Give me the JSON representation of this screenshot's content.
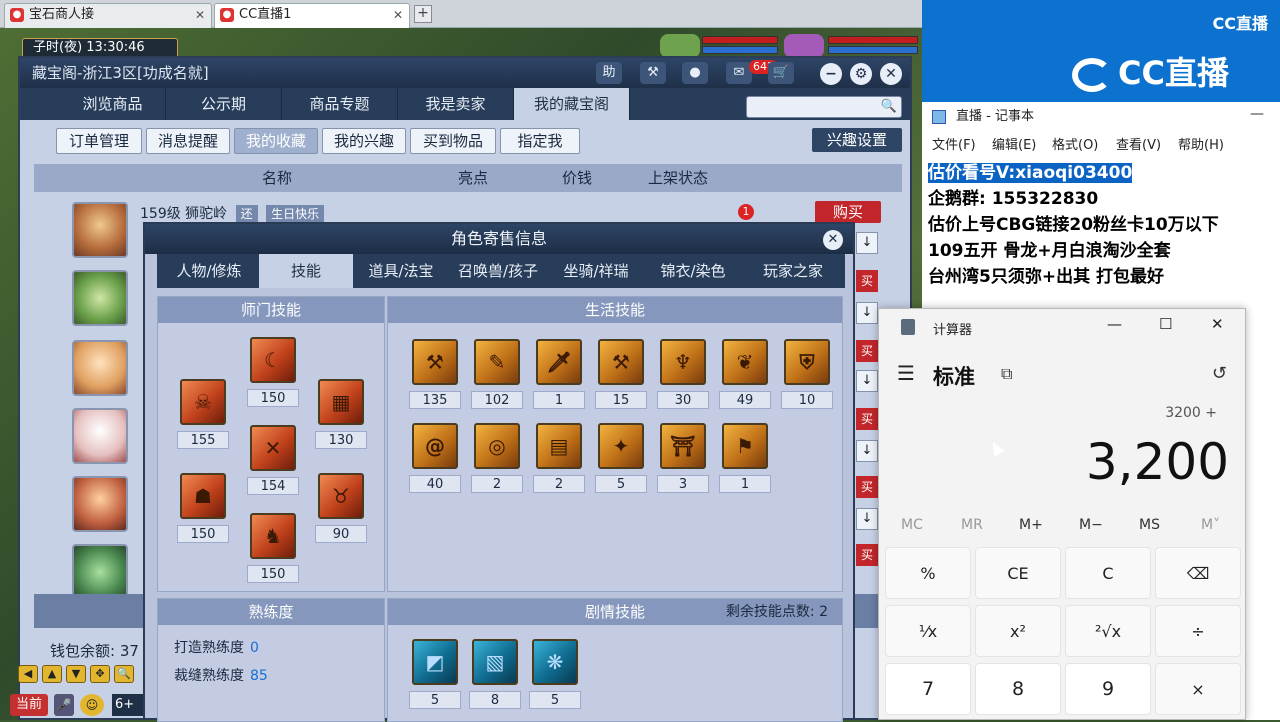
{
  "browser": {
    "tabs": [
      {
        "label": "宝石商人接",
        "active": false
      },
      {
        "label": "CC直播1",
        "active": true
      }
    ]
  },
  "game": {
    "time": "子时(夜)  13:30:46",
    "window_title": "藏宝阁-浙江3区[功成名就]",
    "help_label": "助",
    "message_count": "641",
    "tabs": [
      "浏览商品",
      "公示期",
      "商品专题",
      "我是卖家",
      "我的藏宝阁"
    ],
    "active_tab": 4,
    "subtabs": [
      "订单管理",
      "消息提醒",
      "我的收藏",
      "我的兴趣",
      "买到物品",
      "指定我"
    ],
    "active_subtab": 2,
    "interest_settings": "兴趣设置",
    "columns": [
      "名称",
      "亮点",
      "价钱",
      "上架状态"
    ],
    "row1": {
      "level": "159级 狮驼岭",
      "tag1": "还",
      "tag2": "生日快乐",
      "buy": "购买",
      "notif": "1"
    },
    "side_buttons": [
      "买",
      "买",
      "买",
      "买",
      "买"
    ],
    "wallet": "钱包余额: 37",
    "current_channel": "当前",
    "input_hint": "6+"
  },
  "role_dialog": {
    "title": "角色寄售信息",
    "tabs": [
      "人物/修炼",
      "技能",
      "道具/法宝",
      "召唤兽/孩子",
      "坐骑/祥瑞",
      "锦衣/染色",
      "玩家之家"
    ],
    "active_tab": 1,
    "school_skills_title": "师门技能",
    "life_skills_title": "生活技能",
    "proficiency_title": "熟练度",
    "story_skills_title": "剧情技能",
    "remaining_points_label": "剩余技能点数: 2",
    "school_skills": [
      {
        "icon": "demon-mask-icon",
        "value": "155"
      },
      {
        "icon": "sickle-icon",
        "value": "150"
      },
      {
        "icon": "rune-book-icon",
        "value": "130"
      },
      {
        "icon": "crossed-blades-icon",
        "value": "154"
      },
      {
        "icon": "skull-icon",
        "value": "150"
      },
      {
        "icon": "horns-icon",
        "value": "90"
      },
      {
        "icon": "beast-head-icon",
        "value": "150"
      }
    ],
    "life_skills": [
      {
        "icon": "forge-icon",
        "value": "135"
      },
      {
        "icon": "scroll-icon",
        "value": "102"
      },
      {
        "icon": "dagger-icon",
        "value": "1"
      },
      {
        "icon": "hammer-icon",
        "value": "15"
      },
      {
        "icon": "fish-icon",
        "value": "30"
      },
      {
        "icon": "leaf-icon",
        "value": "49"
      },
      {
        "icon": "shield-icon",
        "value": "10"
      },
      {
        "icon": "coil-icon",
        "value": "40"
      },
      {
        "icon": "ring-icon",
        "value": "2"
      },
      {
        "icon": "maze-icon",
        "value": "2"
      },
      {
        "icon": "lantern-icon",
        "value": "5"
      },
      {
        "icon": "gate-icon",
        "value": "3"
      },
      {
        "icon": "banner-icon",
        "value": "1"
      }
    ],
    "proficiency": [
      {
        "label": "打造熟练度",
        "value": "0"
      },
      {
        "label": "裁缝熟练度",
        "value": "85"
      }
    ],
    "story_skills": [
      {
        "icon": "rune-a-icon",
        "value": "5"
      },
      {
        "icon": "rune-b-icon",
        "value": "8"
      },
      {
        "icon": "rune-c-icon",
        "value": "5"
      }
    ]
  },
  "stream": {
    "logo_small": "CC直播",
    "logo_big": "CC直播"
  },
  "notepad": {
    "title": "直播 - 记事本",
    "menu": [
      "文件(F)",
      "编辑(E)",
      "格式(O)",
      "查看(V)",
      "帮助(H)"
    ],
    "lines": [
      "估价看号V:xiaoqi03400",
      "企鹅群: 155322830",
      "估价上号CBG链接20粉丝卡10万以下",
      "109五开 骨龙+月白浪淘沙全套",
      "台州湾5只须弥+出其 打包最好"
    ]
  },
  "calculator": {
    "title": "计算器",
    "mode": "标准",
    "expression": "3200 +",
    "display": "3,200",
    "memory": [
      "MC",
      "MR",
      "M+",
      "M−",
      "MS",
      "M˅"
    ],
    "keys": [
      "%",
      "CE",
      "C",
      "⌫",
      "¹⁄x",
      "x²",
      "²√x",
      "÷",
      "7",
      "8",
      "9",
      "×"
    ]
  }
}
